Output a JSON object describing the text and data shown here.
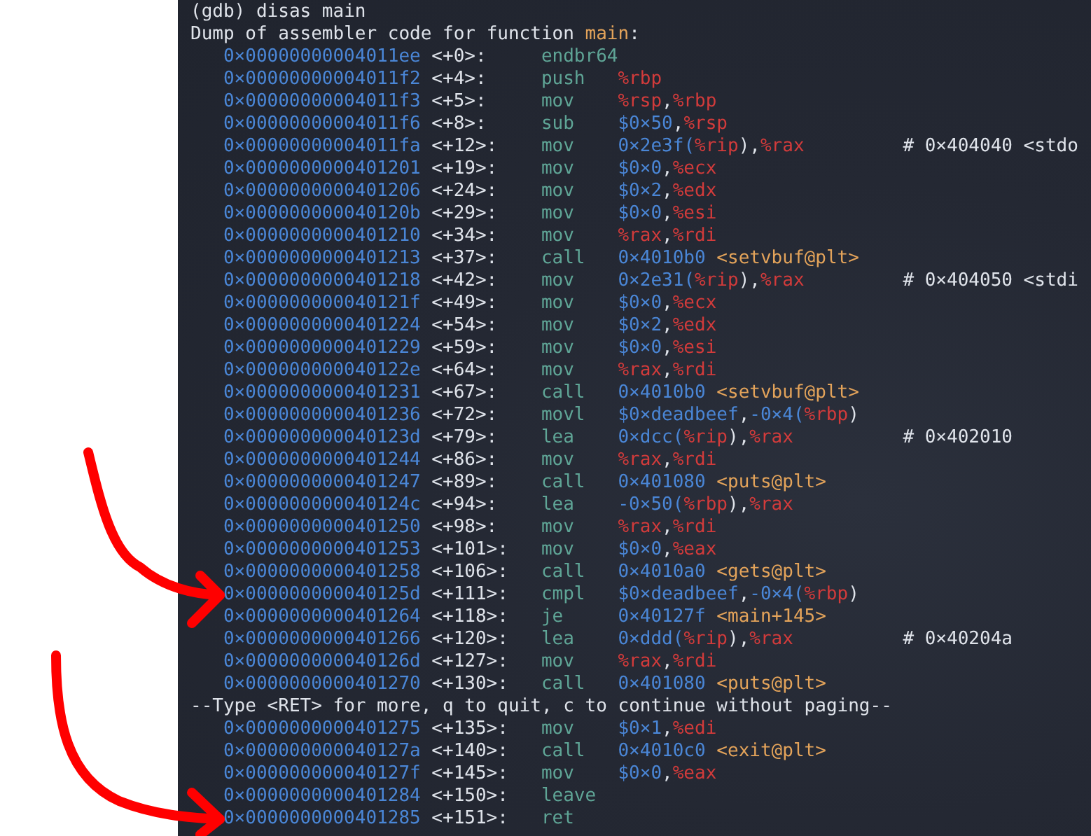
{
  "lines": [
    {
      "kind": "prompt",
      "text": "(gdb) disas main"
    },
    {
      "kind": "header",
      "text": "Dump of assembler code for function ",
      "function": "main",
      "suffix": ":"
    },
    {
      "kind": "instruction",
      "address": "0×00000000004011ee",
      "offset": "<+0>:",
      "mnemonic": "endbr64"
    },
    {
      "kind": "instruction",
      "address": "0×00000000004011f2",
      "offset": "<+4>:",
      "mnemonic": "push",
      "operands": "%rbp"
    },
    {
      "kind": "instruction",
      "address": "0×00000000004011f3",
      "offset": "<+5>:",
      "mnemonic": "mov",
      "operands": "%rsp,%rbp"
    },
    {
      "kind": "instruction",
      "address": "0×00000000004011f6",
      "offset": "<+8>:",
      "mnemonic": "sub",
      "operands": "$0×50,%rsp"
    },
    {
      "kind": "instruction",
      "address": "0×00000000004011fa",
      "offset": "<+12>:",
      "mnemonic": "mov",
      "operands": "0×2e3f(%rip),%rax",
      "comment": "# 0×404040 <stdo"
    },
    {
      "kind": "instruction",
      "address": "0×0000000000401201",
      "offset": "<+19>:",
      "mnemonic": "mov",
      "operands": "$0×0,%ecx"
    },
    {
      "kind": "instruction",
      "address": "0×0000000000401206",
      "offset": "<+24>:",
      "mnemonic": "mov",
      "operands": "$0×2,%edx"
    },
    {
      "kind": "instruction",
      "address": "0×000000000040120b",
      "offset": "<+29>:",
      "mnemonic": "mov",
      "operands": "$0×0,%esi"
    },
    {
      "kind": "instruction",
      "address": "0×0000000000401210",
      "offset": "<+34>:",
      "mnemonic": "mov",
      "operands": "%rax,%rdi"
    },
    {
      "kind": "instruction",
      "address": "0×0000000000401213",
      "offset": "<+37>:",
      "mnemonic": "call",
      "operands": "0×4010b0 <setvbuf@plt>"
    },
    {
      "kind": "instruction",
      "address": "0×0000000000401218",
      "offset": "<+42>:",
      "mnemonic": "mov",
      "operands": "0×2e31(%rip),%rax",
      "comment": "# 0×404050 <stdi"
    },
    {
      "kind": "instruction",
      "address": "0×000000000040121f",
      "offset": "<+49>:",
      "mnemonic": "mov",
      "operands": "$0×0,%ecx"
    },
    {
      "kind": "instruction",
      "address": "0×0000000000401224",
      "offset": "<+54>:",
      "mnemonic": "mov",
      "operands": "$0×2,%edx"
    },
    {
      "kind": "instruction",
      "address": "0×0000000000401229",
      "offset": "<+59>:",
      "mnemonic": "mov",
      "operands": "$0×0,%esi"
    },
    {
      "kind": "instruction",
      "address": "0×000000000040122e",
      "offset": "<+64>:",
      "mnemonic": "mov",
      "operands": "%rax,%rdi"
    },
    {
      "kind": "instruction",
      "address": "0×0000000000401231",
      "offset": "<+67>:",
      "mnemonic": "call",
      "operands": "0×4010b0 <setvbuf@plt>"
    },
    {
      "kind": "instruction",
      "address": "0×0000000000401236",
      "offset": "<+72>:",
      "mnemonic": "movl",
      "operands": "$0×deadbeef,-0×4(%rbp)"
    },
    {
      "kind": "instruction",
      "address": "0×000000000040123d",
      "offset": "<+79>:",
      "mnemonic": "lea",
      "operands": "0×dcc(%rip),%rax",
      "comment": "# 0×402010"
    },
    {
      "kind": "instruction",
      "address": "0×0000000000401244",
      "offset": "<+86>:",
      "mnemonic": "mov",
      "operands": "%rax,%rdi"
    },
    {
      "kind": "instruction",
      "address": "0×0000000000401247",
      "offset": "<+89>:",
      "mnemonic": "call",
      "operands": "0×401080 <puts@plt>"
    },
    {
      "kind": "instruction",
      "address": "0×000000000040124c",
      "offset": "<+94>:",
      "mnemonic": "lea",
      "operands": "-0×50(%rbp),%rax"
    },
    {
      "kind": "instruction",
      "address": "0×0000000000401250",
      "offset": "<+98>:",
      "mnemonic": "mov",
      "operands": "%rax,%rdi"
    },
    {
      "kind": "instruction",
      "address": "0×0000000000401253",
      "offset": "<+101>:",
      "mnemonic": "mov",
      "operands": "$0×0,%eax"
    },
    {
      "kind": "instruction",
      "address": "0×0000000000401258",
      "offset": "<+106>:",
      "mnemonic": "call",
      "operands": "0×4010a0 <gets@plt>"
    },
    {
      "kind": "instruction",
      "address": "0×000000000040125d",
      "offset": "<+111>:",
      "mnemonic": "cmpl",
      "operands": "$0×deadbeef,-0×4(%rbp)"
    },
    {
      "kind": "instruction",
      "address": "0×0000000000401264",
      "offset": "<+118>:",
      "mnemonic": "je",
      "operands": "0×40127f <main+145>"
    },
    {
      "kind": "instruction",
      "address": "0×0000000000401266",
      "offset": "<+120>:",
      "mnemonic": "lea",
      "operands": "0×ddd(%rip),%rax",
      "comment": "# 0×40204a"
    },
    {
      "kind": "instruction",
      "address": "0×000000000040126d",
      "offset": "<+127>:",
      "mnemonic": "mov",
      "operands": "%rax,%rdi"
    },
    {
      "kind": "instruction",
      "address": "0×0000000000401270",
      "offset": "<+130>:",
      "mnemonic": "call",
      "operands": "0×401080 <puts@plt>"
    },
    {
      "kind": "pager",
      "text": "--Type <RET> for more, q to quit, c to continue without paging--"
    },
    {
      "kind": "instruction",
      "address": "0×0000000000401275",
      "offset": "<+135>:",
      "mnemonic": "mov",
      "operands": "$0×1,%edi"
    },
    {
      "kind": "instruction",
      "address": "0×000000000040127a",
      "offset": "<+140>:",
      "mnemonic": "call",
      "operands": "0×4010c0 <exit@plt>"
    },
    {
      "kind": "instruction",
      "address": "0×000000000040127f",
      "offset": "<+145>:",
      "mnemonic": "mov",
      "operands": "$0×0,%eax"
    },
    {
      "kind": "instruction",
      "address": "0×0000000000401284",
      "offset": "<+150>:",
      "mnemonic": "leave"
    },
    {
      "kind": "instruction",
      "address": "0×0000000000401285",
      "offset": "<+151>:",
      "mnemonic": "ret"
    }
  ]
}
